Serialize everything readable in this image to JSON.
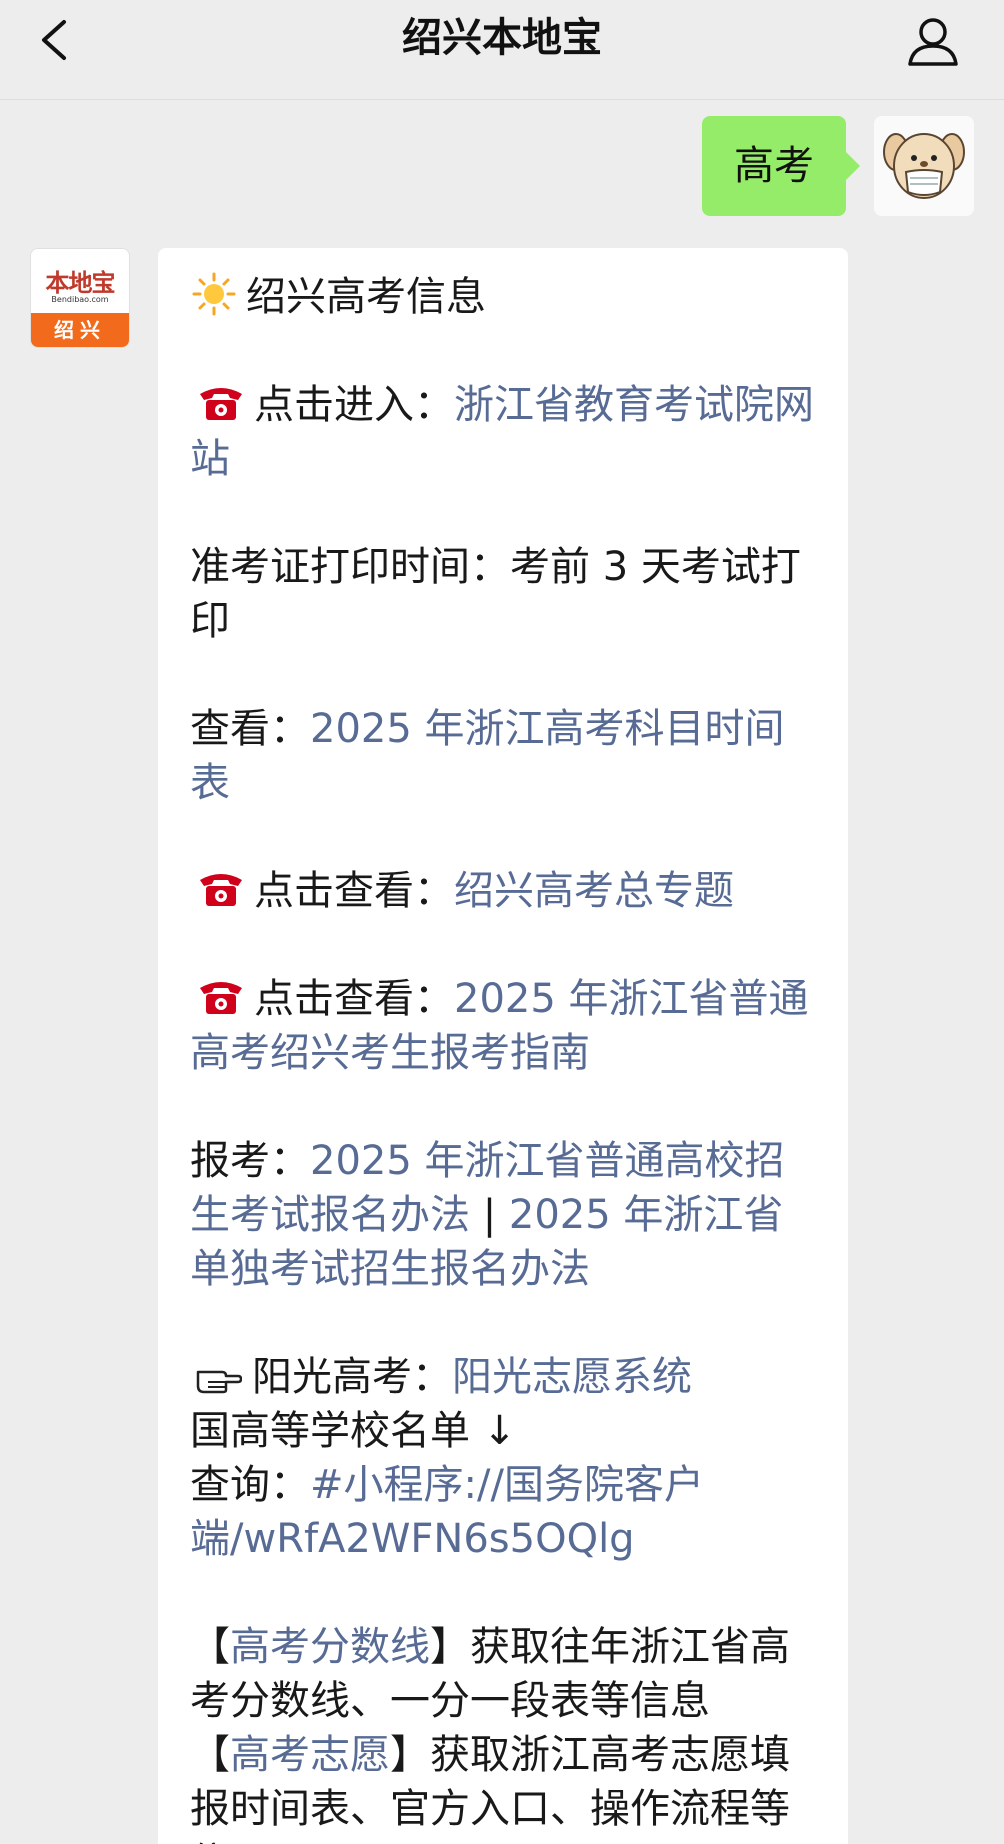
{
  "header": {
    "title": "绍兴本地宝",
    "back_icon": "chevron-left-icon",
    "profile_icon": "person-icon"
  },
  "outgoing": {
    "text": "高考",
    "bubble_color": "#95ec69"
  },
  "bot": {
    "avatar_name": "本地宝",
    "avatar_domain": "Bendibao.com",
    "avatar_city": "绍兴",
    "brand_color": "#f26a1b"
  },
  "message": {
    "heading": "绍兴高考信息",
    "line1_label": "点击进入：",
    "line1_link": "浙江省教育考试院网站",
    "line2_text": "准考证打印时间：考前 3 天考试打印",
    "line3_label": "查看：",
    "line3_link": "2025 年浙江高考科目时间表",
    "line4_label": "点击查看：",
    "line4_link": "绍兴高考总专题",
    "line5_label": "点击查看：",
    "line5_link": "2025 年浙江省普通高考绍兴考生报考指南",
    "line6_label": "报考：",
    "line6_link_a": "2025 年浙江省普通高校招生考试报名办法",
    "line6_sep": " | ",
    "line6_link_b": "2025 年浙江省单独考试招生报名办法",
    "line7_label": "阳光高考：",
    "line7_link": "阳光志愿系统",
    "line8_text": "国高等学校名单 ↓",
    "line9_label": "查询：",
    "line9_link": "#小程序://国务院客户端/wRfA2WFN6s5OQlg",
    "line10_open": "【",
    "line10_link": "高考分数线",
    "line10_rest": "】获取往年浙江省高考分数线、一分一段表等信息",
    "line11_open": "【",
    "line11_link": "高考志愿",
    "line11_rest": "】获取浙江高考志愿填报时间表、官方入口、操作流程等信",
    "link_color": "#576b95"
  }
}
